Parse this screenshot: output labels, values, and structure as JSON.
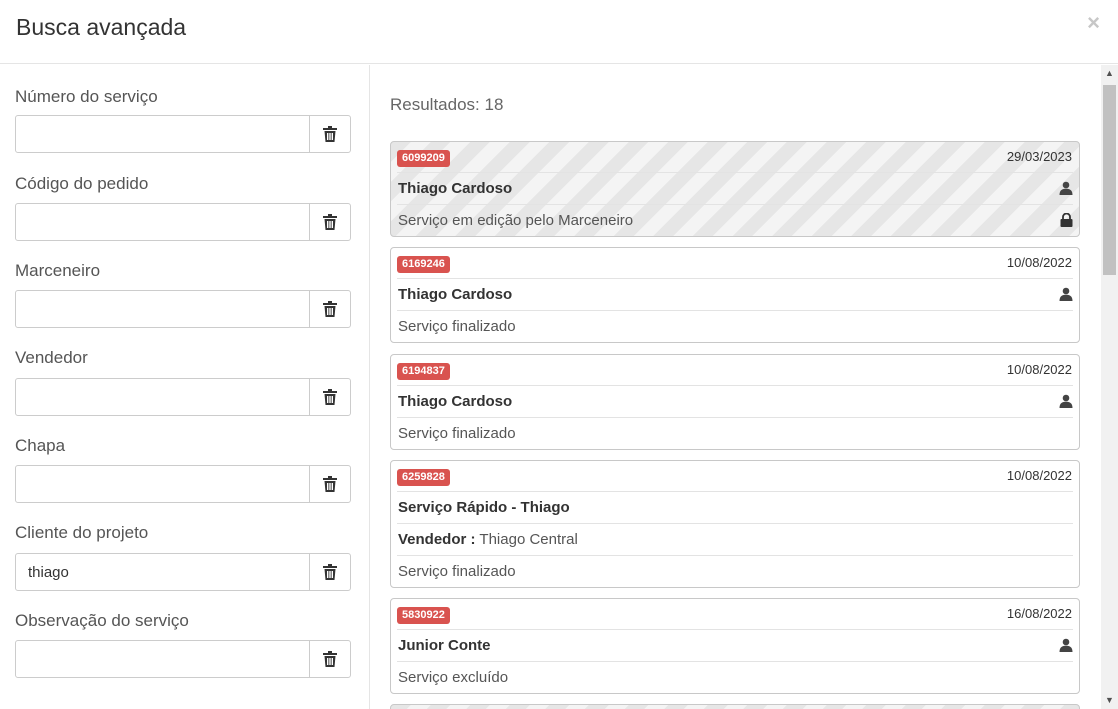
{
  "modal": {
    "title": "Busca avançada",
    "close_symbol": "×"
  },
  "filters": [
    {
      "label": "Número do serviço",
      "value": "",
      "placeholder": ""
    },
    {
      "label": "Código do pedido",
      "value": "",
      "placeholder": ""
    },
    {
      "label": "Marceneiro",
      "value": "",
      "placeholder": ""
    },
    {
      "label": "Vendedor",
      "value": "",
      "placeholder": ""
    },
    {
      "label": "Chapa",
      "value": "",
      "placeholder": ""
    },
    {
      "label": "Cliente do projeto",
      "value": "thiago",
      "placeholder": ""
    },
    {
      "label": "Observação do serviço",
      "value": "",
      "placeholder": ""
    }
  ],
  "results": {
    "label": "Resultados: 18",
    "items": [
      {
        "id": "6099209",
        "date": "29/03/2023",
        "name": "Thiago Cardoso",
        "status": "Serviço em edição pelo Marceneiro",
        "icon": "user-icon",
        "status_icon": "lock-icon",
        "striped": true
      },
      {
        "id": "6169246",
        "date": "10/08/2022",
        "name": "Thiago Cardoso",
        "status": "Serviço finalizado",
        "icon": "user-icon"
      },
      {
        "id": "6194837",
        "date": "10/08/2022",
        "name": "Thiago Cardoso",
        "status": "Serviço finalizado",
        "icon": "user-icon"
      },
      {
        "id": "6259828",
        "date": "10/08/2022",
        "name": "Serviço Rápido - Thiago",
        "seller_label": "Vendedor :",
        "seller": "Thiago Central",
        "status": "Serviço finalizado"
      },
      {
        "id": "5830922",
        "date": "16/08/2022",
        "name": "Junior Conte",
        "status": "Serviço excluído",
        "icon": "user-icon"
      }
    ]
  },
  "colors": {
    "badge": "#d9534f",
    "border": "#c8c8c8",
    "stripe": "#e6e6e6"
  }
}
